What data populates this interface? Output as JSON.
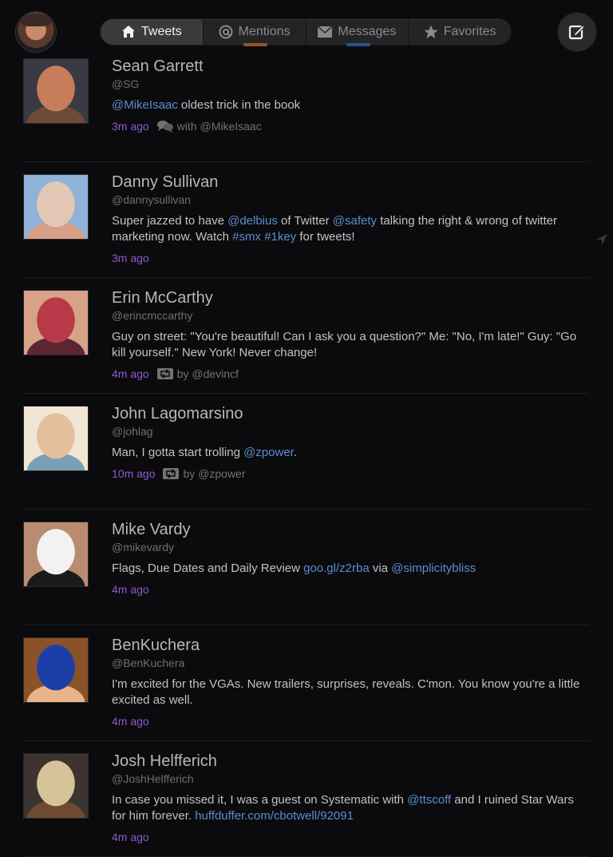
{
  "tabs": [
    {
      "label": "Tweets",
      "icon": "home-icon",
      "active": true
    },
    {
      "label": "Mentions",
      "icon": "at-icon",
      "active": false
    },
    {
      "label": "Messages",
      "icon": "envelope-icon",
      "active": false
    },
    {
      "label": "Favorites",
      "icon": "star-icon",
      "active": false
    }
  ],
  "tweets": [
    {
      "name": "Sean Garrett",
      "handle": "@SG",
      "text_parts": [
        {
          "t": "@MikeIsaac",
          "link": true
        },
        {
          "t": " oldest trick in the book",
          "link": false
        }
      ],
      "time": "3m ago",
      "extra_icon": "conversation-icon",
      "extra": "with @MikeIsaac",
      "colors": [
        "#c77d5c",
        "#6d4b3a",
        "#3a3a44"
      ]
    },
    {
      "name": "Danny Sullivan",
      "handle": "@dannysullivan",
      "text_parts": [
        {
          "t": "Super jazzed to have ",
          "link": false
        },
        {
          "t": "@delbius",
          "link": true
        },
        {
          "t": " of Twitter ",
          "link": false
        },
        {
          "t": "@safety",
          "link": true
        },
        {
          "t": " talking the right & wrong of twitter marketing now. Watch ",
          "link": false
        },
        {
          "t": "#smx",
          "link": true
        },
        {
          "t": " ",
          "link": false
        },
        {
          "t": "#1key",
          "link": true
        },
        {
          "t": " for tweets!",
          "link": false
        }
      ],
      "time": "3m ago",
      "extra_icon": "",
      "extra": "",
      "colors": [
        "#e3c7b5",
        "#d79f86",
        "#8fb2d8"
      ]
    },
    {
      "name": "Erin McCarthy",
      "handle": "@erincmccarthy",
      "text_parts": [
        {
          "t": "Guy on street: \"You're beautiful! Can I ask you a question?\" Me: \"No, I'm late!\" Guy: \"Go kill yourself.\" New York! Never change!",
          "link": false
        }
      ],
      "time": "4m ago",
      "extra_icon": "retweet-icon",
      "extra": "by @devincf",
      "colors": [
        "#b83a48",
        "#5a2630",
        "#d8a289"
      ]
    },
    {
      "name": "John Lagomarsino",
      "handle": "@johlag",
      "text_parts": [
        {
          "t": "Man, I gotta start trolling ",
          "link": false
        },
        {
          "t": "@zpower",
          "link": true
        },
        {
          "t": ".",
          "link": false
        }
      ],
      "time": "10m ago",
      "extra_icon": "retweet-icon",
      "extra": "by @zpower",
      "colors": [
        "#e2c09e",
        "#7aa0b6",
        "#f1e5d4"
      ]
    },
    {
      "name": "Mike Vardy",
      "handle": "@mikevardy",
      "text_parts": [
        {
          "t": "Flags, Due Dates and Daily Review ",
          "link": false
        },
        {
          "t": "goo.gl/z2rba",
          "link": true
        },
        {
          "t": " via ",
          "link": false
        },
        {
          "t": "@simplicitybliss",
          "link": true
        }
      ],
      "time": "4m ago",
      "extra_icon": "",
      "extra": "",
      "colors": [
        "#f2f2f2",
        "#1a1a1a",
        "#b98c72"
      ]
    },
    {
      "name": "BenKuchera",
      "handle": "@BenKuchera",
      "text_parts": [
        {
          "t": "I'm excited for the VGAs. New trailers, surprises, reveals. C'mon. You know you're a little excited as well.",
          "link": false
        }
      ],
      "time": "4m ago",
      "extra_icon": "",
      "extra": "",
      "colors": [
        "#1c3ea8",
        "#e8b48a",
        "#8a5228"
      ]
    },
    {
      "name": "Josh Helfferich",
      "handle": "@JoshHelfferich",
      "text_parts": [
        {
          "t": "In case you missed it, I was a guest on Systematic with ",
          "link": false
        },
        {
          "t": "@ttscoff",
          "link": true
        },
        {
          "t": " and I ruined Star Wars for him forever. ",
          "link": false
        },
        {
          "t": "huffduffer.com/cbotwell/92091",
          "link": true
        }
      ],
      "time": "4m ago",
      "extra_icon": "",
      "extra": "",
      "colors": [
        "#d7c39a",
        "#6e4a30",
        "#3b3430"
      ]
    }
  ]
}
